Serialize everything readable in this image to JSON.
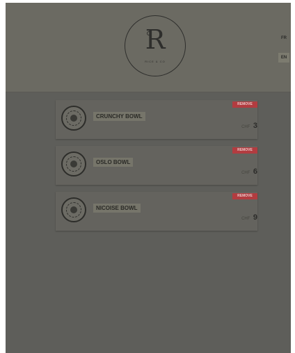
{
  "header": {
    "logo_mark": "R",
    "logo_tagline": "RICE & CO",
    "languages": [
      "FR",
      "EN"
    ],
    "active_language": "EN"
  },
  "menu": {
    "items": [
      {
        "name": "CRUNCHY BOWL",
        "badge": "REMOVE",
        "currency": "CHF",
        "price": "3"
      },
      {
        "name": "OSLO BOWL",
        "badge": "REMOVE",
        "currency": "CHF",
        "price": "6"
      },
      {
        "name": "NICOISE BOWL",
        "badge": "REMOVE",
        "currency": "CHF",
        "price": "9"
      }
    ]
  },
  "colors": {
    "overlay": "#5e5e5a",
    "badge": "#b23c40",
    "active_language_bg": "#7c7b6f"
  }
}
